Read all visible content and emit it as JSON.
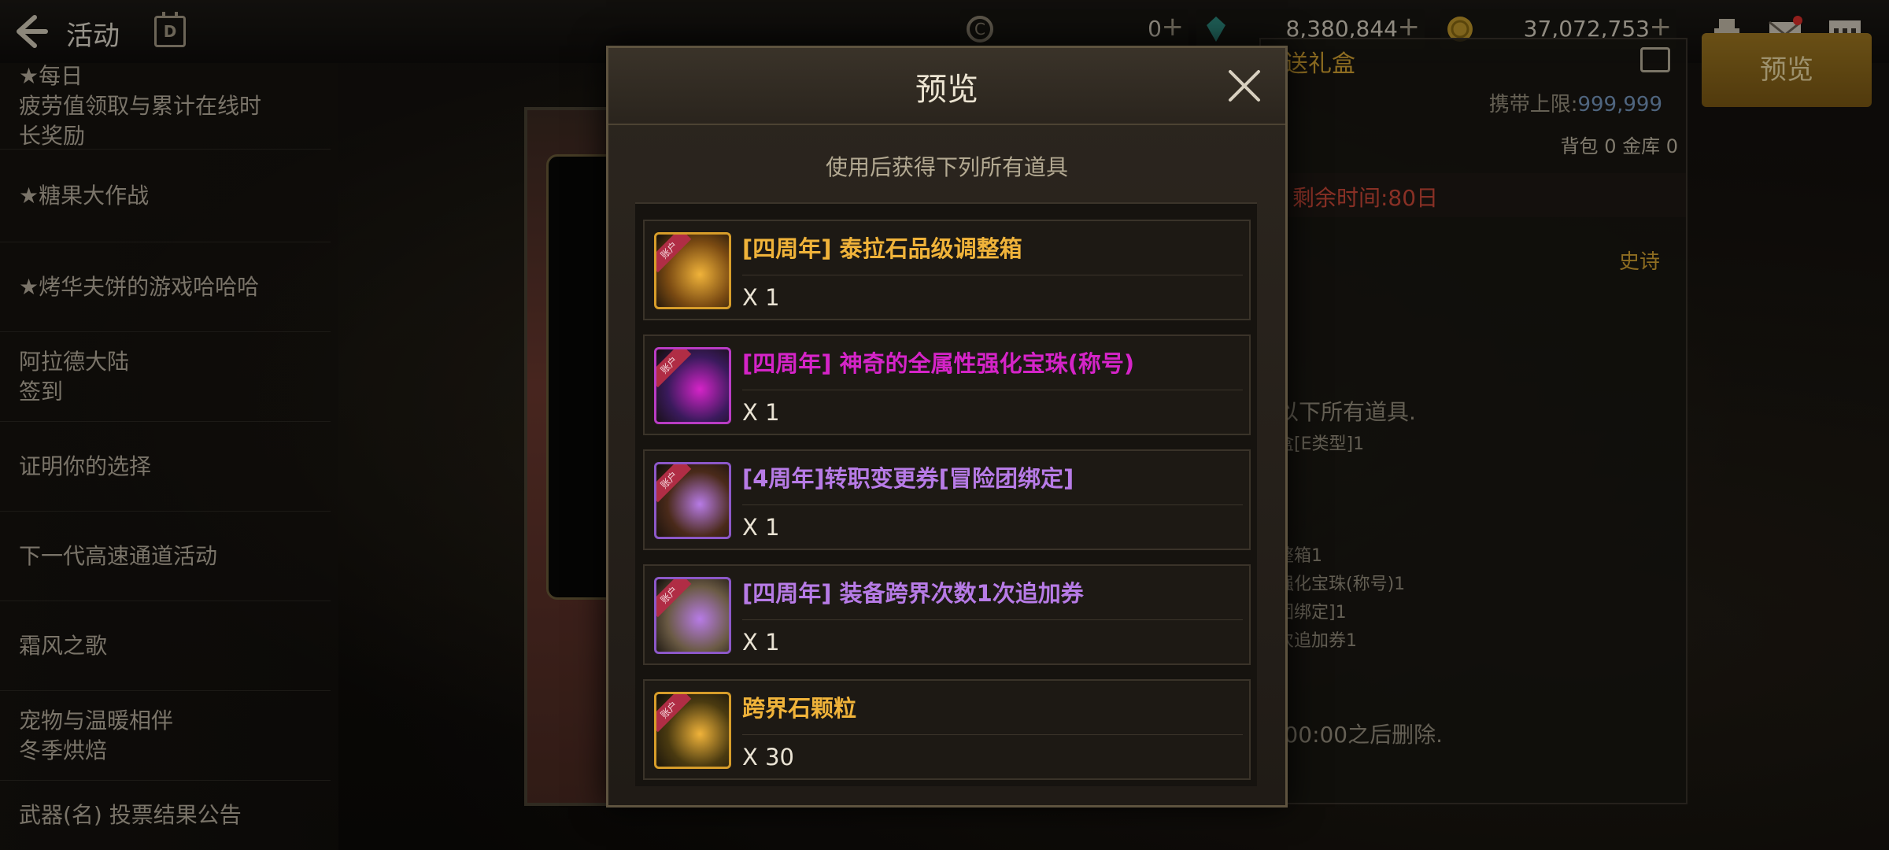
{
  "topbar": {
    "title": "活动",
    "calendar_letter": "D",
    "currencies": [
      {
        "icon": "c-coin-icon",
        "value": "0",
        "color": "#8e8572"
      },
      {
        "icon": "crystal-icon",
        "value": "8,380,844",
        "color": "#2f8f83"
      },
      {
        "icon": "gold-coin-icon",
        "value": "37,072,753",
        "color": "#c49a2c"
      }
    ]
  },
  "preview_button": "预览",
  "sidebar": {
    "items": [
      "★每日\n疲劳值领取与累计在线时\n长奖励",
      "★糖果大作战",
      "★烤华夫饼的游戏哈哈哈",
      "阿拉德大陆\n签到",
      "证明你的选择",
      "下一代高速通道活动",
      "霜风之歌",
      "宠物与温暖相伴\n冬季烘焙",
      "武器(名) 投票结果公告"
    ]
  },
  "background_panel": {
    "title": "送礼盒",
    "limit_label": "携带上限:",
    "limit_value": "999,999",
    "storage": "背包 0 金库 0",
    "remaining_time": "剩余时间:80日",
    "rarity": "史诗",
    "desc_fragment": "以下所有道具.",
    "box_fragment": "盒[E类型]1",
    "contents_fragments": [
      "整箱1",
      "强化宝珠(称号)1",
      "团绑定]1",
      "次追加券1"
    ],
    "delete_fragment": ":00:00之后删除."
  },
  "modal": {
    "title": "预览",
    "subtitle": "使用后获得下列所有道具",
    "items": [
      {
        "name": "[四周年] 泰拉石品级调整箱",
        "qty": "X 1",
        "name_color": "#f0b33a",
        "border_color": "#d79d2a",
        "icon_bg": "#7a4a12",
        "ribbon": "账户"
      },
      {
        "name": "[四周年] 神奇的全属性强化宝珠(称号)",
        "qty": "X 1",
        "name_color": "#d524c8",
        "border_color": "#b93cc4",
        "icon_bg": "#3a1a5c",
        "ribbon": "账户"
      },
      {
        "name": "[4周年]转职变更券[冒险团绑定]",
        "qty": "X 1",
        "name_color": "#b77be6",
        "border_color": "#8c58c8",
        "icon_bg": "#4a2a1a",
        "ribbon": "账户"
      },
      {
        "name": "[四周年] 装备跨界次数1次追加券",
        "qty": "X 1",
        "name_color": "#b77be6",
        "border_color": "#8c58c8",
        "icon_bg": "#6a5a44",
        "ribbon": "账户"
      },
      {
        "name": "跨界石颗粒",
        "qty": "X 30",
        "name_color": "#f0b33a",
        "border_color": "#d79d2a",
        "icon_bg": "#4a3a10",
        "ribbon": "账户"
      }
    ]
  }
}
